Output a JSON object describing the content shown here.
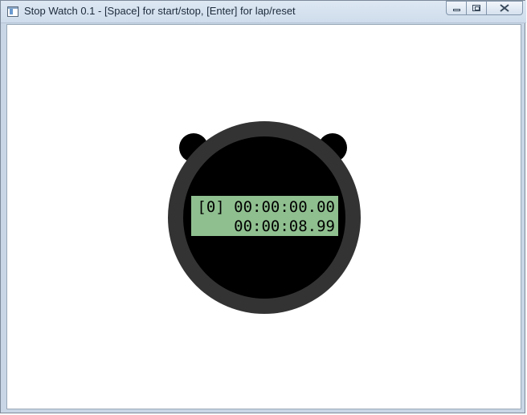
{
  "window": {
    "title": "Stop Watch 0.1 - [Space] for start/stop, [Enter] for lap/reset",
    "controls": {
      "minimize": "minimize-icon",
      "maximize": "restore-icon",
      "close": "close-icon"
    }
  },
  "stopwatch": {
    "lap_line": "[0] 00:00:00.00",
    "time_line": "00:00:08.99",
    "colors": {
      "body": "#000000",
      "rim": "#333333",
      "lcd_background": "#8fbf8f",
      "lcd_text": "#000000"
    }
  }
}
